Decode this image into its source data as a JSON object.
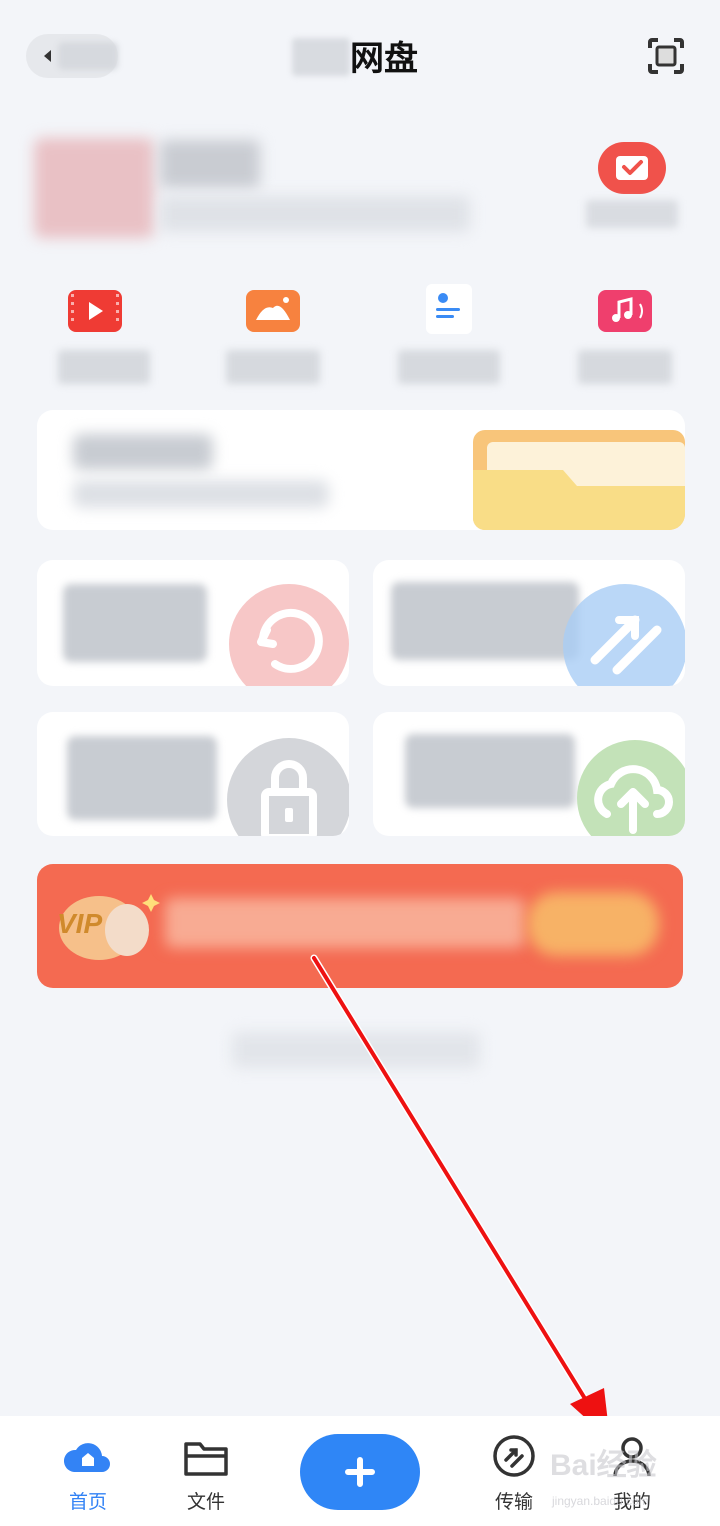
{
  "header": {
    "title": "网盘"
  },
  "bottom_nav": {
    "items": [
      {
        "label": "首页",
        "active": true,
        "icon": "cloud-home-icon"
      },
      {
        "label": "文件",
        "active": false,
        "icon": "folder-icon"
      },
      {
        "label": "",
        "active": false,
        "icon": "plus-icon"
      },
      {
        "label": "传输",
        "active": false,
        "icon": "transfer-icon"
      },
      {
        "label": "我的",
        "active": false,
        "icon": "user-icon"
      }
    ]
  },
  "categories": [
    {
      "icon": "video-icon",
      "color": "#ef3b34"
    },
    {
      "icon": "image-icon",
      "color": "#f7823f"
    },
    {
      "icon": "document-icon",
      "color": "#3a8bf5"
    },
    {
      "icon": "music-icon",
      "color": "#ef3f6d"
    }
  ],
  "vip_banner": {
    "badge": "VIP"
  },
  "watermark": {
    "text": "Bai经验",
    "sub": "jingyan.baidu.com"
  },
  "colors": {
    "accent": "#3383f5",
    "fab": "#2f86f6",
    "vip": "#f46a51",
    "annotation_arrow": "#ee1111"
  }
}
